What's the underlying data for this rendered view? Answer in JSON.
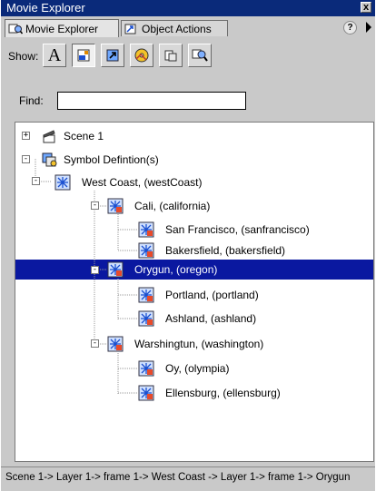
{
  "window": {
    "title": "Movie Explorer",
    "close_label": "x"
  },
  "tabs": [
    {
      "label": "Movie Explorer",
      "icon": "movie-explorer-icon",
      "active": true
    },
    {
      "label": "Object Actions",
      "icon": "object-actions-icon",
      "active": false
    }
  ],
  "help_label": "?",
  "show": {
    "label": "Show:",
    "buttons": [
      {
        "name": "show-text-button",
        "icon": "text-A-icon",
        "glyph": "A",
        "on": false
      },
      {
        "name": "show-buttons-movieclips-graphics-button",
        "icon": "button-icon",
        "on": true
      },
      {
        "name": "show-action-scripts-button",
        "icon": "script-arrow-icon",
        "on": false
      },
      {
        "name": "show-video-sounds-bitmaps-button",
        "icon": "media-icon",
        "on": false
      },
      {
        "name": "show-frames-layers-button",
        "icon": "frames-icon",
        "on": false
      },
      {
        "name": "customize-items-to-show-button",
        "icon": "customize-icon",
        "on": false
      }
    ]
  },
  "find": {
    "label": "Find:",
    "value": "",
    "placeholder": ""
  },
  "tree": {
    "nodes": [
      {
        "label": "Scene 1",
        "icon": "scene-icon",
        "expander": "+"
      },
      {
        "label": "Symbol Defintion(s)",
        "icon": "symbol-definitions-icon",
        "expander": "-"
      },
      {
        "label": "West Coast, (westCoast)",
        "icon": "movieclip-icon",
        "expander": "-"
      },
      {
        "label": "Cali, (california)",
        "icon": "movieclip-icon",
        "expander": "-"
      },
      {
        "label": "San Francisco, (sanfrancisco)",
        "icon": "movieclip-icon",
        "expander": ""
      },
      {
        "label": "Bakersfield, (bakersfield)",
        "icon": "movieclip-icon",
        "expander": ""
      },
      {
        "label": "Orygun, (oregon)",
        "icon": "movieclip-icon",
        "expander": "-",
        "selected": true
      },
      {
        "label": "Portland, (portland)",
        "icon": "movieclip-icon",
        "expander": ""
      },
      {
        "label": "Ashland, (ashland)",
        "icon": "movieclip-icon",
        "expander": ""
      },
      {
        "label": "Warshingtun, (washington)",
        "icon": "movieclip-icon",
        "expander": "-"
      },
      {
        "label": "Oy, (olympia)",
        "icon": "movieclip-icon",
        "expander": ""
      },
      {
        "label": "Ellensburg, (ellensburg)",
        "icon": "movieclip-icon",
        "expander": ""
      }
    ]
  },
  "status_path": "Scene 1-> Layer 1-> frame 1-> West Coast -> Layer 1-> frame 1-> Orygun",
  "colors": {
    "selection": "#0a18a0",
    "titlebar": "#0a2a7a",
    "panel": "#c9c9c9"
  }
}
